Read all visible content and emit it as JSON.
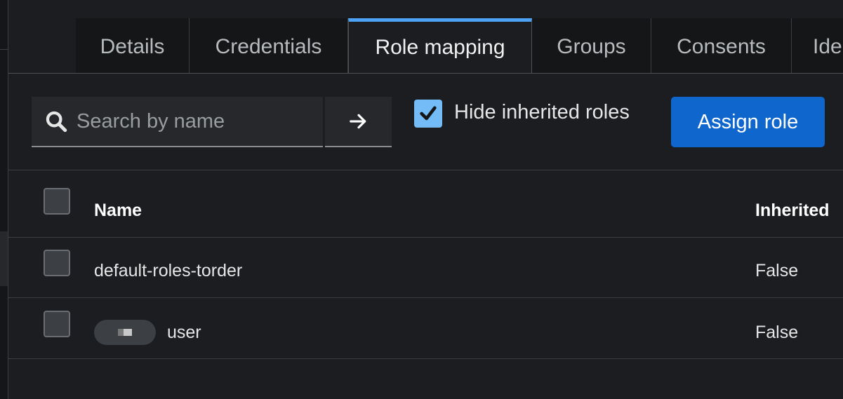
{
  "tabs": [
    {
      "label": "Details"
    },
    {
      "label": "Credentials"
    },
    {
      "label": "Role mapping"
    },
    {
      "label": "Groups"
    },
    {
      "label": "Consents"
    },
    {
      "label": "Ide"
    }
  ],
  "active_tab": "Role mapping",
  "toolbar": {
    "search_placeholder": "Search by name",
    "search_value": "",
    "hide_inherited_label": "Hide inherited roles",
    "hide_inherited_checked": true,
    "assign_label": "Assign role"
  },
  "table": {
    "columns": [
      "Name",
      "Inherited"
    ],
    "rows": [
      {
        "name": "default-roles-torder",
        "inherited": "False"
      },
      {
        "name": "user",
        "inherited": "False"
      }
    ]
  },
  "colors": {
    "accent": "#0f66cc",
    "active_tab_border": "#4ca3f5",
    "checkbox_checked": "#73bcf7"
  }
}
